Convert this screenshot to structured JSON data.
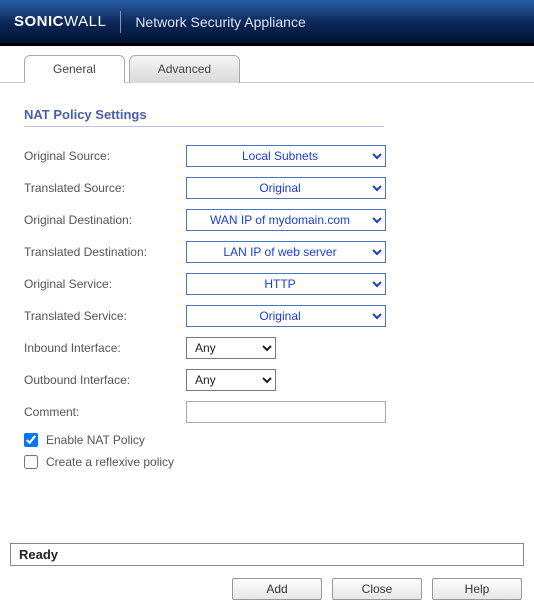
{
  "header": {
    "brand_strong": "SONIC",
    "brand_light": "WALL",
    "subtitle": "Network Security Appliance"
  },
  "tabs": {
    "general": "General",
    "advanced": "Advanced"
  },
  "section_title": "NAT Policy Settings",
  "fields": {
    "original_source": {
      "label": "Original Source:",
      "value": "Local Subnets"
    },
    "translated_source": {
      "label": "Translated Source:",
      "value": "Original"
    },
    "original_destination": {
      "label": "Original Destination:",
      "value": "WAN IP of mydomain.com"
    },
    "translated_destination": {
      "label": "Translated Destination:",
      "value": "LAN IP of web server"
    },
    "original_service": {
      "label": "Original Service:",
      "value": "HTTP"
    },
    "translated_service": {
      "label": "Translated Service:",
      "value": "Original"
    },
    "inbound_interface": {
      "label": "Inbound Interface:",
      "value": "Any"
    },
    "outbound_interface": {
      "label": "Outbound Interface:",
      "value": "Any"
    },
    "comment": {
      "label": "Comment:",
      "value": ""
    }
  },
  "checkboxes": {
    "enable_nat": {
      "label": "Enable NAT Policy",
      "checked": true
    },
    "reflexive": {
      "label": "Create a reflexive policy",
      "checked": false
    }
  },
  "status": "Ready",
  "buttons": {
    "add": "Add",
    "close": "Close",
    "help": "Help"
  }
}
